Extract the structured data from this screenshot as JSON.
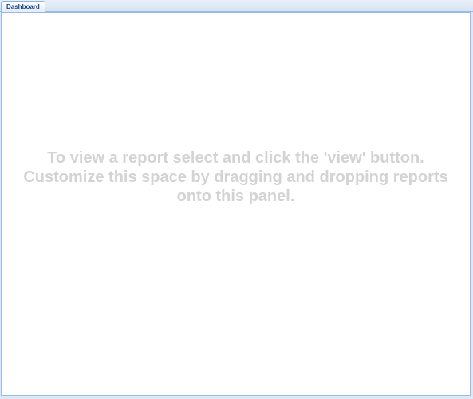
{
  "tabs": [
    {
      "label": "Dashboard",
      "active": true
    }
  ],
  "panel": {
    "hint_line1": "To view a report select and click the 'view' button.",
    "hint_line2": "Customize this space by dragging and dropping reports",
    "hint_line3": "onto this panel."
  },
  "colors": {
    "tab_text": "#15428b",
    "border": "#99bbe8",
    "hint_text": "#d3d3d3",
    "background": "#dfe8f6"
  }
}
